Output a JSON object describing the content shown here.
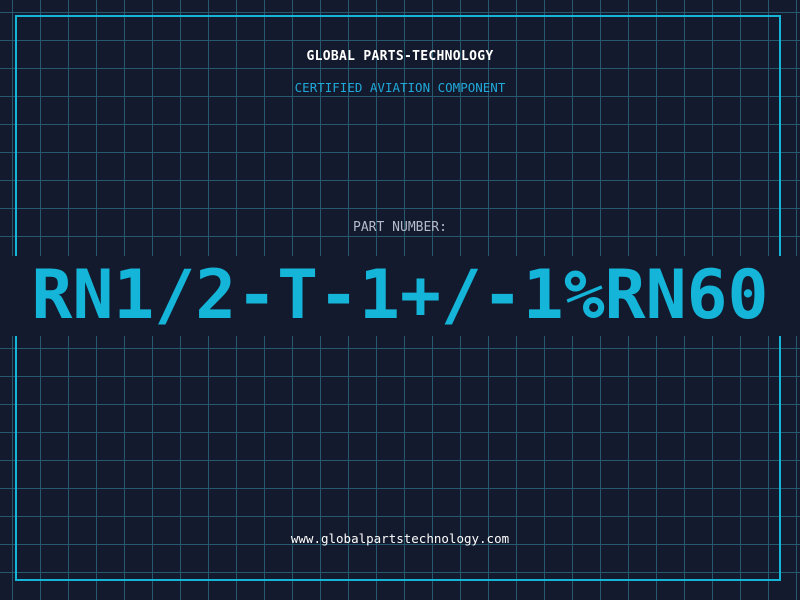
{
  "header": {
    "company": "GLOBAL PARTS-TECHNOLOGY",
    "subtitle": "CERTIFIED AVIATION COMPONENT"
  },
  "part": {
    "label": "PART NUMBER:",
    "value": "RN1/2-T-1+/-1%RN60"
  },
  "footer": {
    "website": "www.globalpartstechnology.com"
  },
  "colors": {
    "background": "#131a2d",
    "grid": "#285f76",
    "accent": "#14b5d8",
    "text": "#ffffff",
    "muted": "#b3bccb"
  }
}
